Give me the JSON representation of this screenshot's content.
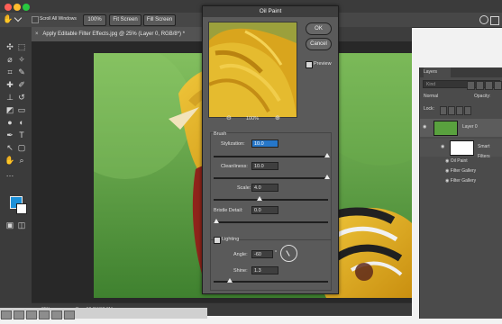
{
  "app": {
    "options_bar": {
      "scroll_all_windows": "Scroll All Windows",
      "zoom_100": "100%",
      "fit_screen": "Fit Screen",
      "fill_screen": "Fill Screen"
    },
    "document_tab": "Apply Editable Filter Effects.jpg @ 25% (Layer 0, RGB/8*) *",
    "status": {
      "zoom": "25%",
      "doc_size": "Doc: 92.8M/92.8M"
    }
  },
  "dialog": {
    "title": "Oil Paint",
    "buttons": {
      "ok": "OK",
      "cancel": "Cancel"
    },
    "preview_label": "Preview",
    "zoom": "100%",
    "brush": {
      "title": "Brush",
      "stylization_label": "Stylization:",
      "stylization_value": "10.0",
      "cleanliness_label": "Cleanliness:",
      "cleanliness_value": "10.0",
      "scale_label": "Scale:",
      "scale_value": "4.0",
      "bristle_label": "Bristle Detail:",
      "bristle_value": "0.0"
    },
    "lighting": {
      "title": "Lighting",
      "angle_label": "Angle:",
      "angle_value": "-60",
      "angle_unit": "°",
      "shine_label": "Shine:",
      "shine_value": "1.3"
    }
  },
  "layers_panel": {
    "tab": "Layers",
    "search_placeholder": "Kind",
    "blend_mode": "Normal",
    "opacity_label": "Opacity:",
    "lock_label": "Lock:",
    "layer_name": "Layer 0",
    "smart_filters": "Smart Filters",
    "filters": [
      "Oil Paint",
      "Filter Gallery",
      "Filter Gallery"
    ]
  },
  "colors": {
    "accent_blue": "#1c90d8",
    "canvas_green": "#5c9f42",
    "bird_yellow": "#e4b72a",
    "bird_red": "#8f241b"
  }
}
